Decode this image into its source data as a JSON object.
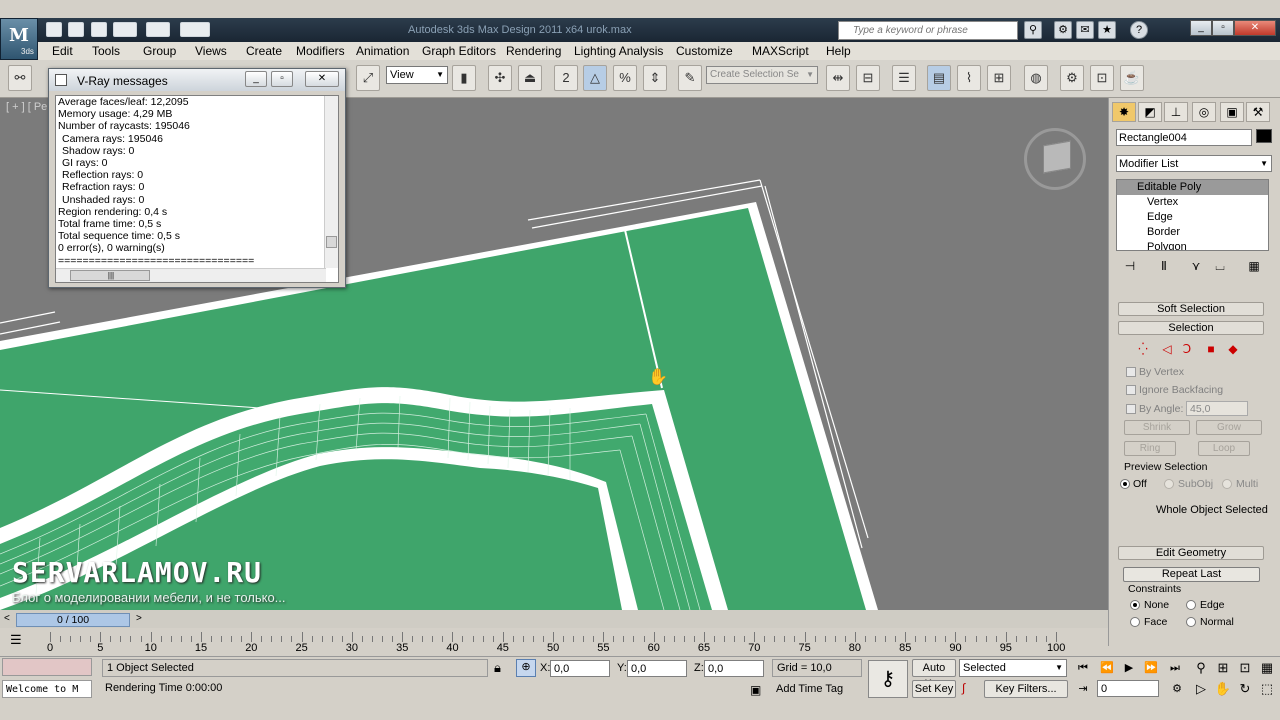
{
  "window": {
    "title": "Autodesk 3ds Max Design 2011 x64      urok.max",
    "logo_text": "M",
    "logo_sub": "3ds"
  },
  "search": {
    "placeholder": "Type a keyword or phrase"
  },
  "menu": [
    "Edit",
    "Tools",
    "Group",
    "Views",
    "Create",
    "Modifiers",
    "Animation",
    "Graph Editors",
    "Rendering",
    "Lighting Analysis",
    "Customize",
    "MAXScript",
    "Help"
  ],
  "toolbar": {
    "ref_coord": "View",
    "selection_set_placeholder": "Create Selection Se"
  },
  "viewport": {
    "label": "[ + ] [ Pers",
    "watermark_title": "SERVARLAMOV.RU",
    "watermark_subtitle": "Блог о моделировании мебели, и не только..."
  },
  "vray": {
    "title": "V-Ray messages",
    "lines": [
      "Average faces/leaf: 12,2095",
      "Memory usage: 4,29 MB",
      "Number of raycasts: 195046",
      "  Camera rays: 195046",
      "  Shadow rays: 0",
      "  GI rays: 0",
      "  Reflection rays: 0",
      "  Refraction rays: 0",
      "  Unshaded rays: 0",
      "Region rendering: 0,4 s",
      "Total frame time: 0,5 s",
      "Total sequence time: 0,5 s",
      "0 error(s), 0 warning(s)",
      "================================"
    ]
  },
  "command_panel": {
    "object_name": "Rectangle004",
    "object_color": "#000000",
    "modifier_list": "Modifier List",
    "stack": [
      "Editable Poly",
      "Vertex",
      "Edge",
      "Border",
      "Polygon"
    ],
    "rollouts": {
      "soft_selection": "Soft Selection",
      "selection": "Selection",
      "edit_geometry": "Edit Geometry"
    },
    "by_vertex": "By Vertex",
    "ignore_backfacing": "Ignore Backfacing",
    "by_angle": "By Angle:",
    "by_angle_value": "45,0",
    "shrink": "Shrink",
    "grow": "Grow",
    "ring": "Ring",
    "loop": "Loop",
    "preview_selection": "Preview Selection",
    "preview_off": "Off",
    "preview_subobj": "SubObj",
    "preview_multi": "Multi",
    "whole_object": "Whole Object Selected",
    "repeat_last": "Repeat Last",
    "constraints": "Constraints",
    "c_none": "None",
    "c_edge": "Edge",
    "c_face": "Face",
    "c_normal": "Normal"
  },
  "timeline": {
    "slider": "0 / 100",
    "ticks": [
      "0",
      "5",
      "10",
      "15",
      "20",
      "25",
      "30",
      "35",
      "40",
      "45",
      "50",
      "55",
      "60",
      "65",
      "70",
      "75",
      "80",
      "85",
      "90",
      "95",
      "100"
    ]
  },
  "status": {
    "selected": "1 Object Selected",
    "rendering_time": "Rendering Time  0:00:00",
    "welcome": "Welcome to M",
    "x_label": "X:",
    "x_value": "0,0",
    "y_label": "Y:",
    "y_value": "0,0",
    "z_label": "Z:",
    "z_value": "0,0",
    "grid": "Grid = 10,0",
    "add_time_tag": "Add Time Tag",
    "auto_key": "Auto Key",
    "set_key": "Set Key",
    "selected_dropdown": "Selected",
    "key_filters": "Key Filters...",
    "frame": "0"
  },
  "colors": {
    "floor_green": "#3fa56b",
    "viewport_bg": "#7b7b7b",
    "panel": "#d4d0c8"
  }
}
